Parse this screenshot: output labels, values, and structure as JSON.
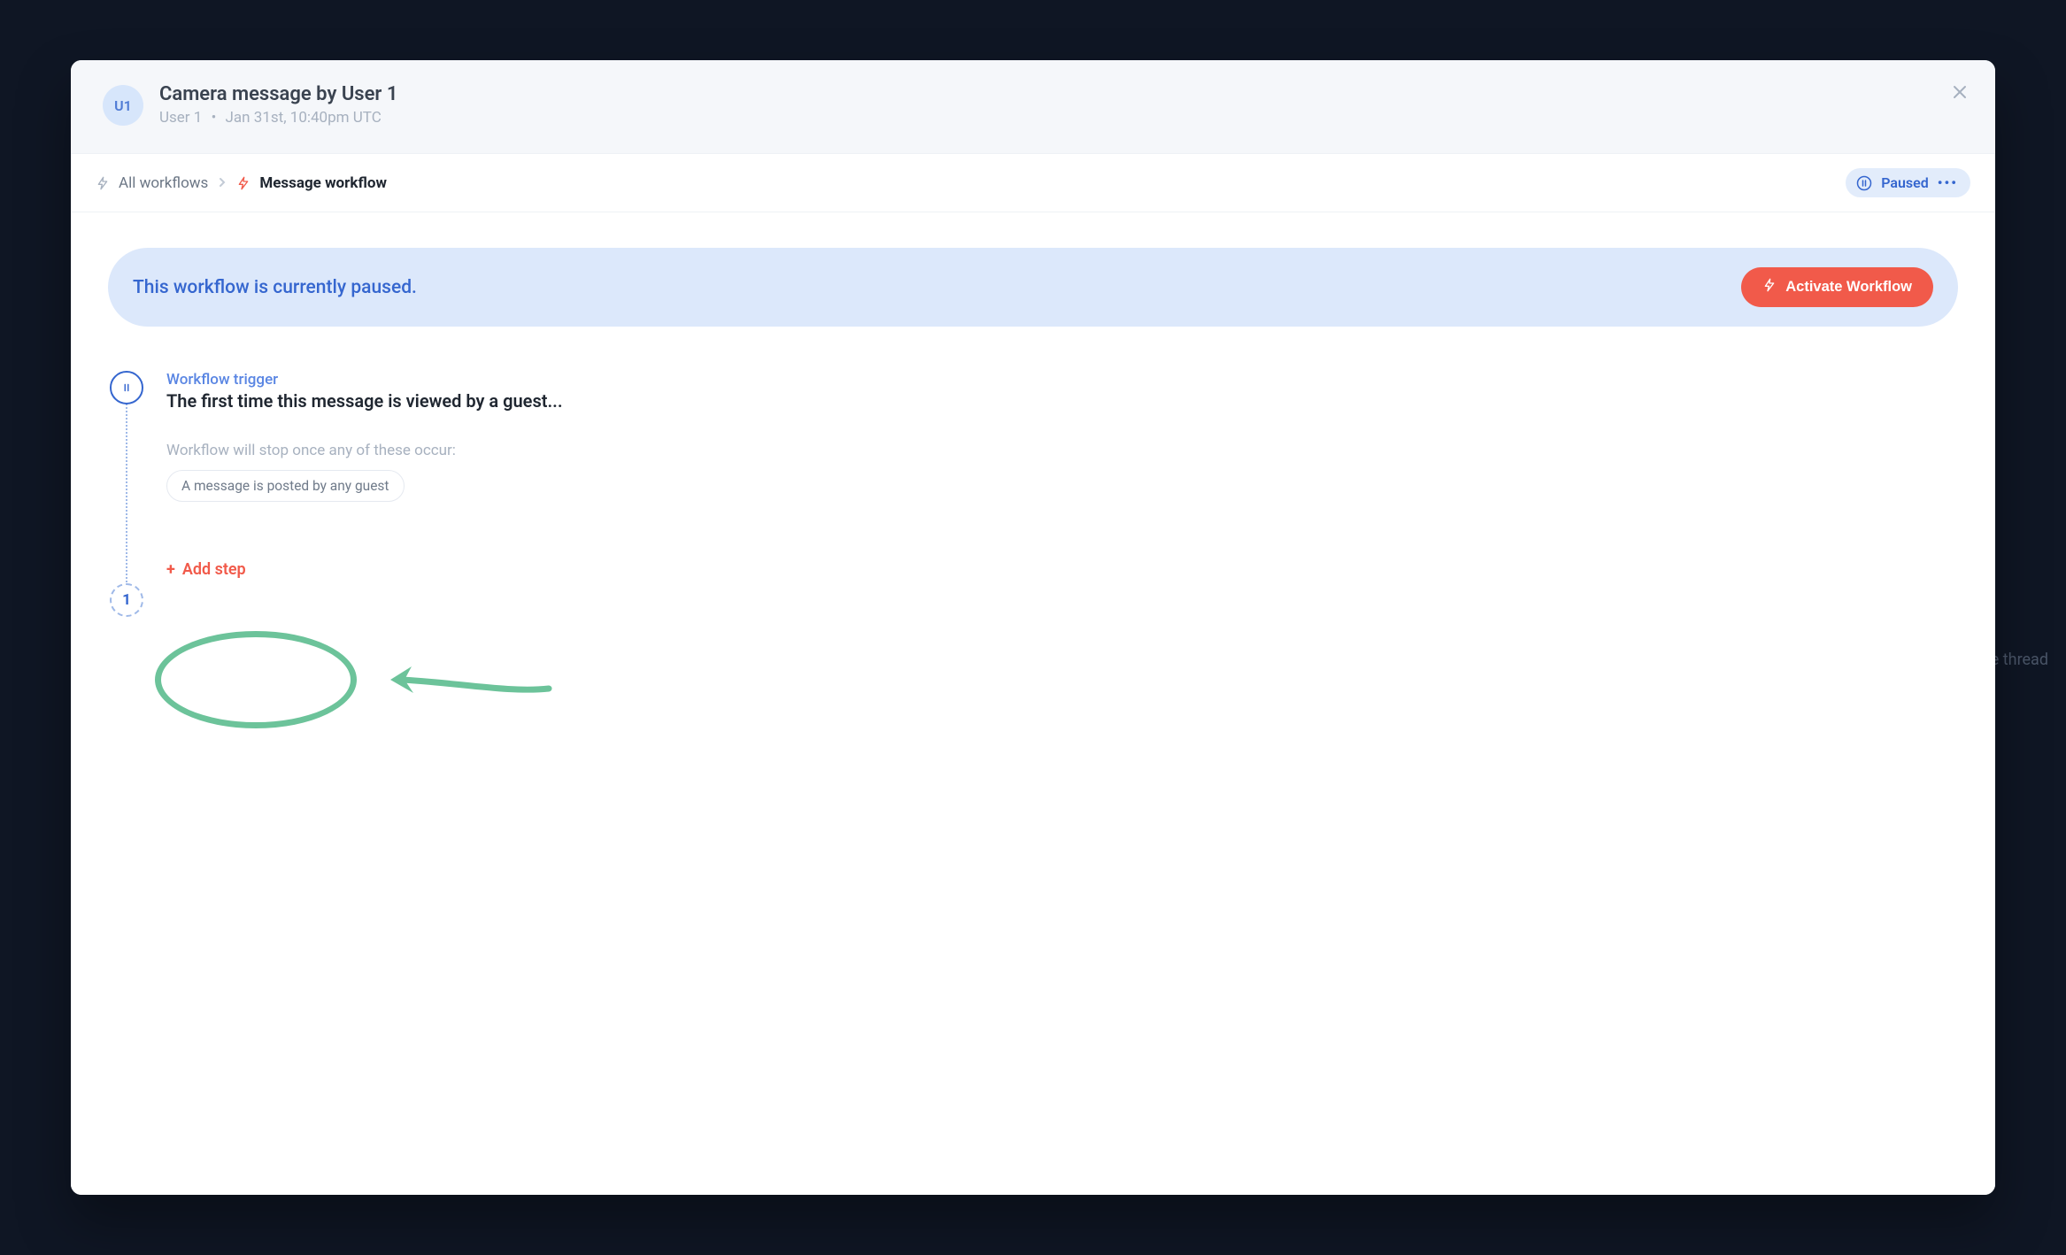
{
  "header": {
    "avatar_initials": "U1",
    "title": "Camera message by User 1",
    "author": "User 1",
    "timestamp": "Jan 31st, 10:40pm UTC"
  },
  "breadcrumb": {
    "all_workflows": "All workflows",
    "current": "Message workflow"
  },
  "status": {
    "label": "Paused"
  },
  "banner": {
    "text": "This workflow is currently paused.",
    "button": "Activate Workflow"
  },
  "trigger": {
    "label": "Workflow trigger",
    "description": "The first time this message is viewed by a guest..."
  },
  "stop": {
    "label": "Workflow will stop once any of these occur:",
    "condition": "A message is posted by any guest"
  },
  "steps": {
    "next_number": "1",
    "add_label": "Add step"
  },
  "background": {
    "thread_hint": "e thread"
  }
}
